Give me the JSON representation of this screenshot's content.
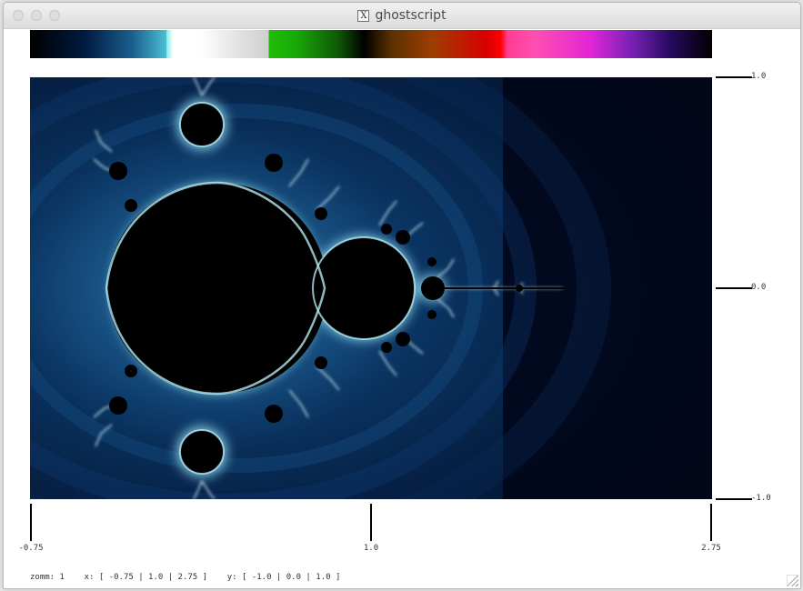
{
  "window": {
    "title": "ghostscript",
    "app_icon": "x11-icon"
  },
  "colorbar": {
    "colors": [
      "#000000",
      "#001a40",
      "#1a5f8e",
      "#4abfd0",
      "#80ecea",
      "#ffffff",
      "#e0e0e0",
      "#21bd09",
      "#0f5b06",
      "#000000",
      "#5a3200",
      "#9e3d00",
      "#d80000",
      "#ff0000",
      "#ff3d91",
      "#ff4fb1",
      "#e326d6",
      "#7b22b8",
      "#240a5d",
      "#000000"
    ]
  },
  "plot": {
    "y_ticks": [
      "1.0",
      "0.0",
      "-1.0"
    ],
    "x_ticks": [
      "-0.75",
      "1.0",
      "2.75"
    ],
    "colors": {
      "set": "#000000",
      "far_background": "#02071a",
      "mid_background": "#062449",
      "near_glow": "#1e5c8f",
      "edge_glow": "#9ee7f7",
      "filament": "#d8fbff"
    }
  },
  "status": {
    "text": "zomm: 1    x: [ -0.75 | 1.0 | 2.75 ]    y: [ -1.0 | 0.0 | 1.0 ]"
  }
}
